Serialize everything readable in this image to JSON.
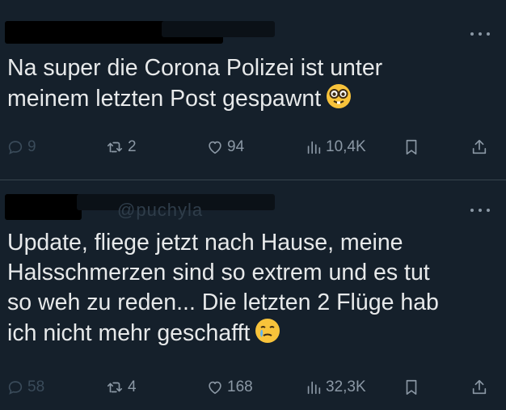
{
  "tweets": [
    {
      "text": "Na super die Corona Polizei ist unter\nmeinem letzten Post gespawnt",
      "emoji": "nerd-face",
      "stats": {
        "replies": "9",
        "retweets": "2",
        "likes": "94",
        "views": "10,4K"
      }
    },
    {
      "handle_fragment": "@puchyla",
      "text": "Update, fliege jetzt nach Hause, meine\nHalsschmerzen sind so extrem und es tut\nso weh zu reden... Die letzten 2 Flüge hab\nich nicht mehr geschafft",
      "emoji": "face-holding-back-tears",
      "stats": {
        "replies": "58",
        "retweets": "4",
        "likes": "168",
        "views": "32,3K"
      }
    }
  ],
  "colors": {
    "background": "#15202b",
    "text": "#e7e9ea",
    "muted": "#8b98a5",
    "divider": "#38444d"
  }
}
